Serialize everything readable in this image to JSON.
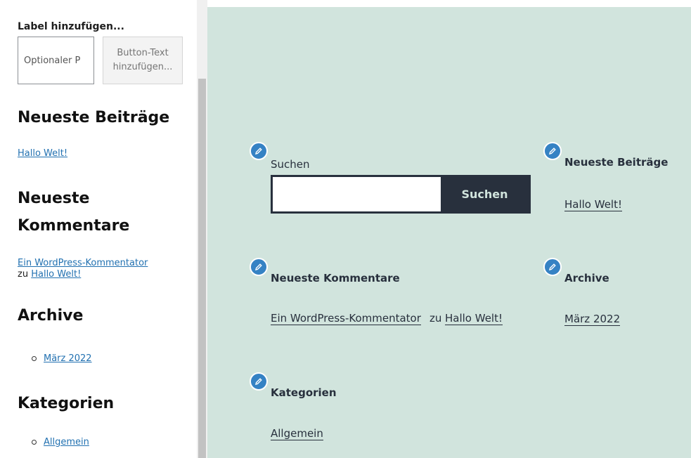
{
  "editor": {
    "search_block": {
      "label": "Label hinzufügen...",
      "input_placeholder": "Optionaler P",
      "button_text": "Button-Text hinzufügen..."
    },
    "recent_posts": {
      "heading": "Neueste Beiträge",
      "post": "Hallo Welt!"
    },
    "recent_comments": {
      "heading_line1": "Neueste",
      "heading_line2": "Kommentare",
      "author": "Ein WordPress-Kommentator",
      "connector": "zu",
      "post": "Hallo Welt!"
    },
    "archives": {
      "heading": "Archive",
      "items": [
        "März 2022"
      ]
    },
    "categories": {
      "heading": "Kategorien",
      "items": [
        "Allgemein"
      ]
    }
  },
  "preview": {
    "search": {
      "heading": "Suchen",
      "button": "Suchen"
    },
    "recent_posts": {
      "heading": "Neueste Beiträge",
      "post": "Hallo Welt!"
    },
    "recent_comments": {
      "heading": "Neueste Kommentare",
      "author": "Ein WordPress-Kommentator",
      "connector": "zu",
      "post": "Hallo Welt!"
    },
    "archives": {
      "heading": "Archive",
      "item": "März 2022"
    },
    "categories": {
      "heading": "Kategorien",
      "item": "Allgemein"
    },
    "colors": {
      "background": "#d1e4dd",
      "text": "#28303d",
      "pencil": "#3582c4"
    }
  }
}
